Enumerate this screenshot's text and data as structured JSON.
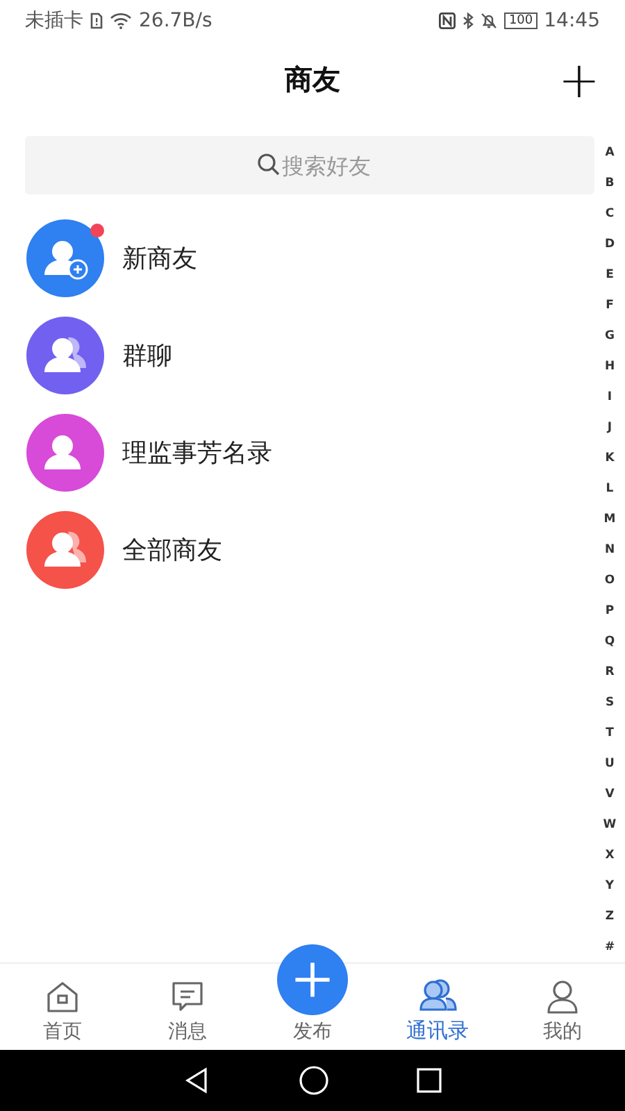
{
  "status_bar": {
    "carrier": "未插卡",
    "speed": "26.7B/s",
    "battery": "100",
    "time": "14:45"
  },
  "header": {
    "title": "商友",
    "add_button": "+"
  },
  "search": {
    "placeholder": "搜索好友"
  },
  "contacts": [
    {
      "name": "新商友",
      "kind": "new",
      "color": "#2f80f0",
      "unread": true
    },
    {
      "name": "群聊",
      "kind": "group",
      "color": "#7260f0",
      "unread": false
    },
    {
      "name": "理监事芳名录",
      "kind": "single",
      "color": "#d84ad8",
      "unread": false
    },
    {
      "name": "全部商友",
      "kind": "group",
      "color": "#f5524a",
      "unread": false
    }
  ],
  "index": [
    "A",
    "B",
    "C",
    "D",
    "E",
    "F",
    "G",
    "H",
    "I",
    "J",
    "K",
    "L",
    "M",
    "N",
    "O",
    "P",
    "Q",
    "R",
    "S",
    "T",
    "U",
    "V",
    "W",
    "X",
    "Y",
    "Z",
    "#"
  ],
  "tabs": [
    {
      "label": "首页",
      "kind": "home",
      "selected": false
    },
    {
      "label": "消息",
      "kind": "message",
      "selected": false
    },
    {
      "label": "发布",
      "kind": "publish",
      "selected": false
    },
    {
      "label": "通讯录",
      "kind": "contacts",
      "selected": true
    },
    {
      "label": "我的",
      "kind": "me",
      "selected": false
    }
  ]
}
